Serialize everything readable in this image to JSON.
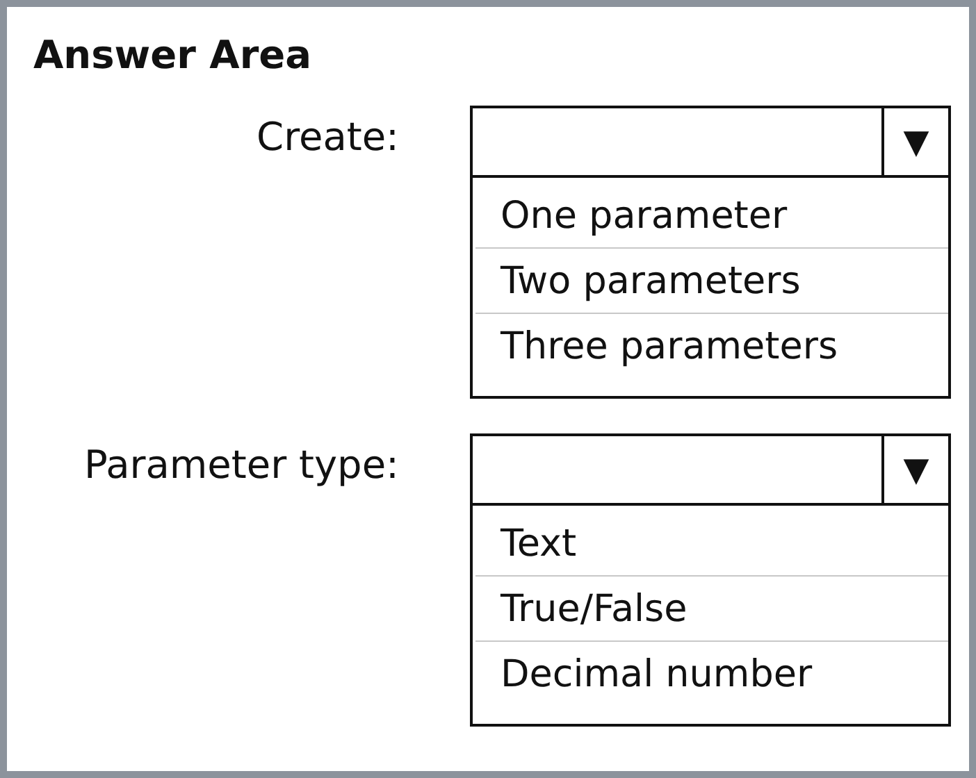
{
  "title": "Answer Area",
  "questions": [
    {
      "label": "Create:",
      "arrow": "▼",
      "options": [
        "One parameter",
        "Two parameters",
        "Three parameters"
      ]
    },
    {
      "label": "Parameter type:",
      "arrow": "▼",
      "options": [
        "Text",
        "True/False",
        "Decimal number"
      ]
    }
  ]
}
